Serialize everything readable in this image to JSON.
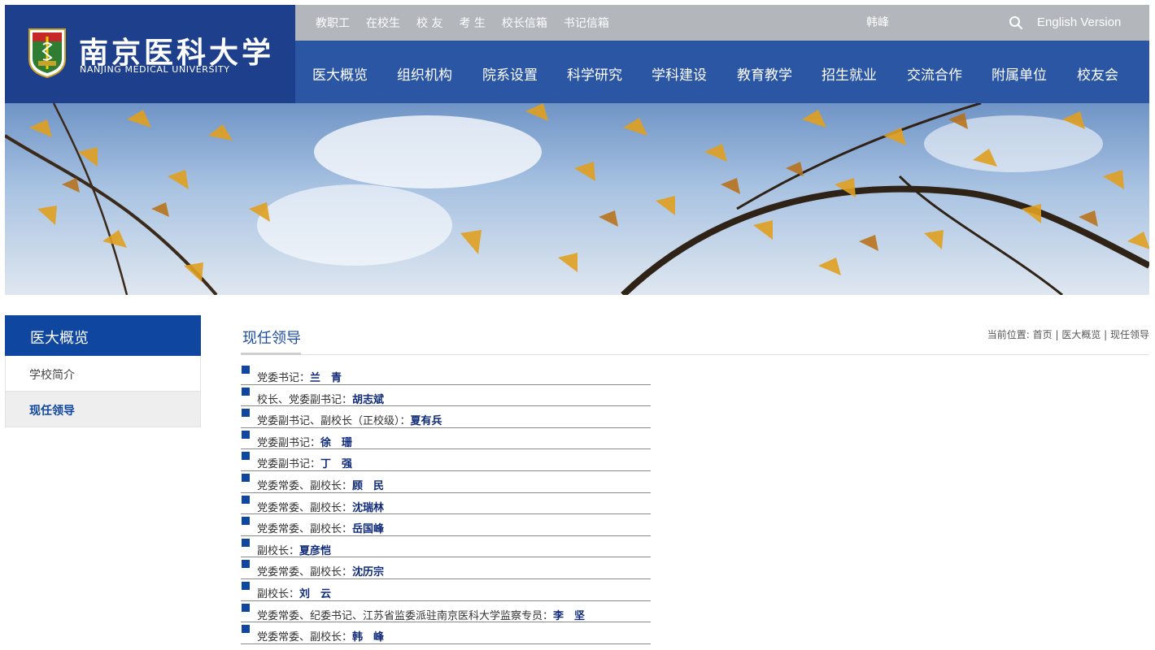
{
  "header": {
    "logo_cn": "南京医科大学",
    "logo_en": "NANJING MEDICAL UNIVERSITY",
    "top_links": [
      "教职工",
      "在校生",
      "校 友",
      "考 生",
      "校长信箱",
      "书记信箱"
    ],
    "top_name": "韩峰",
    "english_label": "English Version",
    "nav": [
      "医大概览",
      "组织机构",
      "院系设置",
      "科学研究",
      "学科建设",
      "教育教学",
      "招生就业",
      "交流合作",
      "附属单位",
      "校友会"
    ]
  },
  "sidebar": {
    "title": "医大概览",
    "items": [
      {
        "label": "学校简介",
        "active": false
      },
      {
        "label": "现任领导",
        "active": true
      }
    ]
  },
  "content": {
    "title": "现任领导",
    "breadcrumb": "当前位置: 首页 | 医大概览 | 现任领导",
    "leaders": [
      {
        "role": "党委书记：",
        "name": "兰　青"
      },
      {
        "role": "校长、党委副书记：",
        "name": "胡志斌"
      },
      {
        "role": "党委副书记、副校长（正校级）：",
        "name": "夏有兵"
      },
      {
        "role": "党委副书记：",
        "name": "徐　珊"
      },
      {
        "role": "党委副书记：",
        "name": "丁　强"
      },
      {
        "role": "党委常委、副校长：",
        "name": "顾　民"
      },
      {
        "role": "党委常委、副校长：",
        "name": "沈瑞林"
      },
      {
        "role": "党委常委、副校长：",
        "name": "岳国峰"
      },
      {
        "role": "副校长：",
        "name": "夏彦恺"
      },
      {
        "role": "党委常委、副校长：",
        "name": "沈历宗"
      },
      {
        "role": "副校长：",
        "name": "刘　云"
      },
      {
        "role": "党委常委、纪委书记、江苏省监委派驻南京医科大学监察专员：",
        "name": "李　坚"
      },
      {
        "role": "党委常委、副校长：",
        "name": "韩　峰"
      }
    ]
  },
  "colors": {
    "logo_bg": "#1d3f8c",
    "topbar_bg": "#b3b6bb",
    "nav_bg": "#2b56a3",
    "accent": "#0f47a0"
  }
}
